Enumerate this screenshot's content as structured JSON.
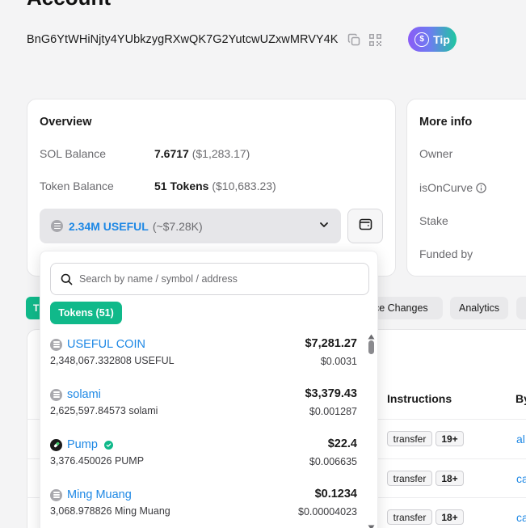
{
  "page": {
    "title": "Account"
  },
  "account": {
    "address": "BnG6YtWHiNjty4YUbkzygRXwQK7G2YutcwUZxwMRVY4K",
    "tip_label": "Tip",
    "tip_coin_symbol": "$"
  },
  "overview": {
    "title": "Overview",
    "sol_label": "SOL Balance",
    "sol_value": "7.6717",
    "sol_usd": "($1,283.17)",
    "token_label": "Token Balance",
    "token_value": "51 Tokens",
    "token_usd": "($10,683.23)",
    "selected_token": {
      "amount": "2.34M USEFUL",
      "approx": "(~$7.28K)"
    }
  },
  "more_info": {
    "title": "More info",
    "owner_label": "Owner",
    "oncurve_label": "isOnCurve",
    "stake_label": "Stake",
    "funded_label": "Funded by"
  },
  "tabs": {
    "first_initial": "T",
    "balance_changes": "nce Changes",
    "analytics": "Analytics"
  },
  "table": {
    "headers": {
      "instructions": "Instructions",
      "by": "By"
    },
    "rows": [
      {
        "instruction": "transfer",
        "count": "19+",
        "by": "al"
      },
      {
        "instruction": "transfer",
        "count": "18+",
        "by": "ca"
      },
      {
        "instruction": "transfer",
        "count": "18+",
        "by": "ca"
      }
    ]
  },
  "dropdown": {
    "search_placeholder": "Search by name / symbol / address",
    "tokens_chip": "Tokens (51)",
    "tokens": [
      {
        "name": "USEFUL COIN",
        "amount": "2,348,067.332808 USEFUL",
        "value": "$7,281.27",
        "price": "$0.0031",
        "icon": "generic-token-icon",
        "verified": false
      },
      {
        "name": "solami",
        "amount": "2,625,597.84573 solami",
        "value": "$3,379.43",
        "price": "$0.001287",
        "icon": "generic-token-icon",
        "verified": false
      },
      {
        "name": "Pump",
        "amount": "3,376.450026 PUMP",
        "value": "$22.4",
        "price": "$0.006635",
        "icon": "pump-icon",
        "verified": true
      },
      {
        "name": "Ming Muang",
        "amount": "3,068.978826 Ming Muang",
        "value": "$0.1234",
        "price": "$0.00004023",
        "icon": "generic-token-icon",
        "verified": false
      }
    ]
  },
  "colors": {
    "accent_blue": "#1e88e5",
    "accent_green": "#10b98a",
    "tip_gradient_start": "#8b5cf6",
    "tip_gradient_end": "#1ec7a0"
  }
}
